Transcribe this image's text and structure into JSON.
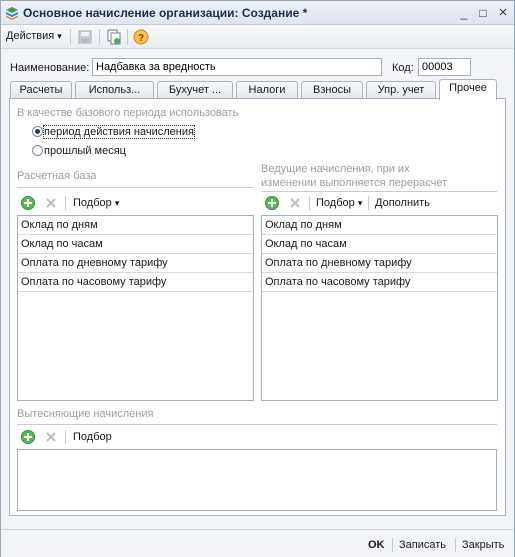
{
  "window": {
    "title": "Основное начисление организации: Создание *",
    "minimize_glyph": "_",
    "maximize_glyph": "□",
    "close_glyph": "×",
    "app_icon": "1c-form-icon"
  },
  "toolbar": {
    "actions_label": "Действия",
    "dropdown_glyph": "▾",
    "icons": [
      "save-disabled-icon",
      "copy-icon",
      "help-icon"
    ],
    "help_glyph": "?"
  },
  "form": {
    "name_label": "Наименование:",
    "name_value": "Надбавка за вредность",
    "code_label": "Код:",
    "code_value": "00003"
  },
  "tabs": [
    {
      "label": "Расчеты",
      "active": false
    },
    {
      "label": "Использ...",
      "active": false
    },
    {
      "label": "Бухучет ...",
      "active": false
    },
    {
      "label": "Налоги",
      "active": false
    },
    {
      "label": "Взносы",
      "active": false
    },
    {
      "label": "Упр. учет",
      "active": false
    },
    {
      "label": "Прочее",
      "active": true
    }
  ],
  "base_period": {
    "title": "В качестве базового периода использовать",
    "options": [
      {
        "label": "период действия начисления",
        "checked": true
      },
      {
        "label": "прошлый месяц",
        "checked": false
      }
    ]
  },
  "calc_base": {
    "title": "Расчетная база",
    "selection_label": "Подбор",
    "rows": [
      "Оклад по дням",
      "Оклад по часам",
      "Оплата по дневному тарифу",
      "Оплата по часовому тарифу"
    ]
  },
  "leading": {
    "title_line1": "Ведущие начисления, при их",
    "title_line2": "изменении выполняется перерасчет",
    "selection_label": "Подбор",
    "add_more_label": "Дополнить",
    "rows": [
      "Оклад по дням",
      "Оклад по часам",
      "Оплата по дневному тарифу",
      "Оплата по часовому тарифу"
    ]
  },
  "displacing": {
    "title": "Вытесняющие начисления",
    "selection_label": "Подбор"
  },
  "footer": {
    "ok_label": "OK",
    "save_label": "Записать",
    "close_label": "Закрыть"
  },
  "colors": {
    "add_icon": "#4caf50",
    "delete_icon_disabled": "#b8bec6",
    "help_icon": "#f0a020",
    "section_title": "#9a9ea6"
  }
}
